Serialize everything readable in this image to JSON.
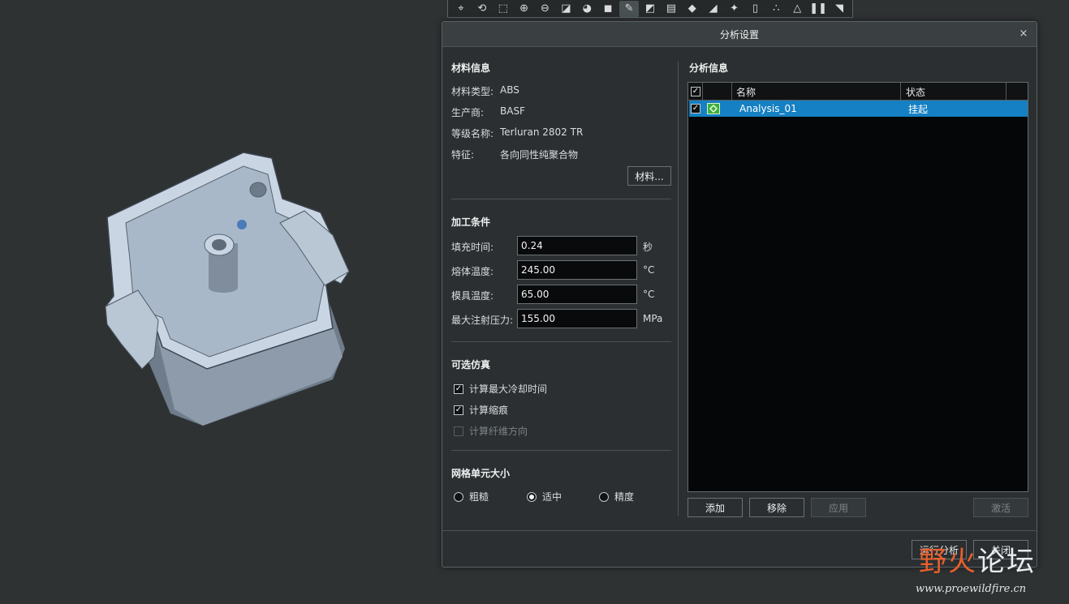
{
  "colors": {
    "background": "#2e3233",
    "dialog_bg": "#2b2f31",
    "selection": "#1580c3",
    "model_face": "#a9b8c9",
    "watermark_orange": "#e8602d"
  },
  "toolbar": {
    "icons": [
      "camera-icon",
      "spin-center-icon",
      "zoom-window-icon",
      "zoom-in-icon",
      "zoom-out-icon",
      "refit-icon",
      "appearance-icon",
      "shading-icon",
      "view-manager-icon",
      "saved-views-icon",
      "display-style-icon",
      "perspective-icon",
      "section-icon",
      "annotation-icon",
      "datum-icon",
      "spin-center-icon",
      "sketch-icon",
      "pause-icon",
      "exit-icon"
    ],
    "glyphs": [
      "⌖",
      "⟲",
      "⬚",
      "⊕",
      "⊖",
      "◪",
      "◕",
      "◼",
      "✎",
      "◩",
      "▤",
      "◆",
      "◢",
      "✦",
      "▯",
      "∴",
      "△",
      "❚❚",
      "◥"
    ]
  },
  "dialog": {
    "title": "分析设置",
    "close_glyph": "×",
    "material": {
      "section_title": "材料信息",
      "type_label": "材料类型:",
      "type_value": "ABS",
      "maker_label": "生产商:",
      "maker_value": "BASF",
      "grade_label": "等级名称:",
      "grade_value": "Terluran 2802 TR",
      "feature_label": "特征:",
      "feature_value": "各向同性纯聚合物",
      "button_label": "材料..."
    },
    "process": {
      "section_title": "加工条件",
      "fill_time_label": "填充时间:",
      "fill_time_value": "0.24",
      "fill_time_unit": "秒",
      "melt_temp_label": "熔体温度:",
      "melt_temp_value": "245.00",
      "melt_temp_unit": "°C",
      "mold_temp_label": "模具温度:",
      "mold_temp_value": "65.00",
      "mold_temp_unit": "°C",
      "pressure_label": "最大注射压力:",
      "pressure_value": "155.00",
      "pressure_unit": "MPa"
    },
    "optional": {
      "section_title": "可选仿真",
      "options": [
        {
          "label": "计算最大冷却时间",
          "checked": true,
          "enabled": true
        },
        {
          "label": "计算缩痕",
          "checked": true,
          "enabled": true
        },
        {
          "label": "计算纤维方向",
          "checked": false,
          "enabled": false
        }
      ]
    },
    "mesh": {
      "section_title": "网格单元大小",
      "options": [
        {
          "label": "粗糙",
          "selected": false
        },
        {
          "label": "适中",
          "selected": true
        },
        {
          "label": "精度",
          "selected": false
        }
      ]
    },
    "analysis": {
      "section_title": "分析信息",
      "columns": {
        "name": "名称",
        "status": "状态"
      },
      "rows": [
        {
          "name": "Analysis_01",
          "status": "挂起",
          "checked": true
        }
      ],
      "buttons": {
        "add": "添加",
        "remove": "移除",
        "apply": "应用",
        "activate": "激活"
      }
    },
    "footer": {
      "run": "运行分析",
      "close": "关闭"
    }
  },
  "watermark": {
    "brand_part1": "野火",
    "brand_part2": "论坛",
    "url": "www.proewildfire.cn"
  }
}
